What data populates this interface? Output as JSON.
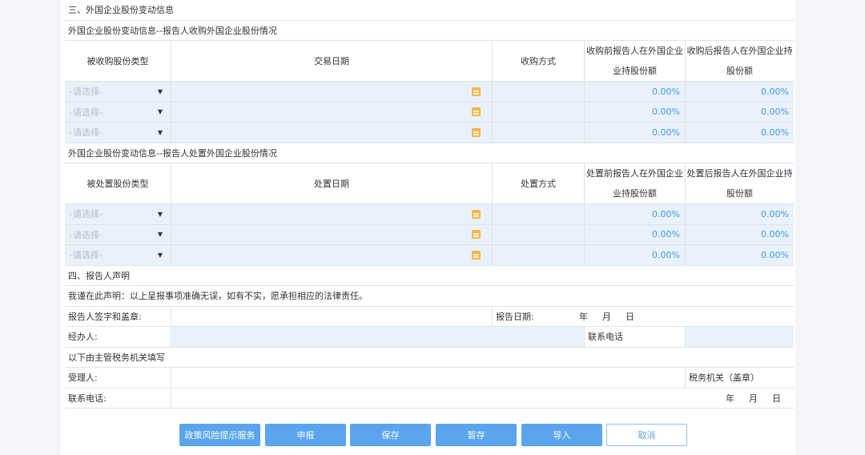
{
  "section3_title": "三、外国企业股份变动信息",
  "acquire": {
    "title": "外国企业股份变动信息--报告人收购外国企业股份情况",
    "headers": [
      "被收购股份类型",
      "交易日期",
      "收购方式",
      "收购前报告人在外国企业业持股份额",
      "收购后报告人在外国企业持股份额"
    ],
    "rows": [
      {
        "type": "-请选择-",
        "pct_before": "0.00%",
        "pct_after": "0.00%"
      },
      {
        "type": "-请选择-",
        "pct_before": "0.00%",
        "pct_after": "0.00%"
      },
      {
        "type": "-请选择-",
        "pct_before": "0.00%",
        "pct_after": "0.00%"
      }
    ]
  },
  "dispose": {
    "title": "外国企业股份变动信息--报告人处置外国企业股份情况",
    "headers": [
      "被处置股份类型",
      "处置日期",
      "处置方式",
      "处置前报告人在外国企业业持股份额",
      "处置后报告人在外国企业持股份额"
    ],
    "rows": [
      {
        "type": "-请选择-",
        "pct_before": "0.00%",
        "pct_after": "0.00%"
      },
      {
        "type": "-请选择-",
        "pct_before": "0.00%",
        "pct_after": "0.00%"
      },
      {
        "type": "-请选择-",
        "pct_before": "0.00%",
        "pct_after": "0.00%"
      }
    ]
  },
  "section4_title": "四、报告人声明",
  "declaration": "我谨在此声明：以上呈报事项准确无误，如有不实，愿承担相应的法律责任。",
  "signature_label": "报告人签字和盖章:",
  "report_date_label": "报告日期:",
  "date_parts": [
    "年",
    "月",
    "日"
  ],
  "handler_label": "经办人:",
  "contact_phone_label": "联系电话",
  "tax_fill_title": "以下由主管税务机关填写",
  "receiver_label": "受理人:",
  "tax_office_label": "税务机关（盖章）",
  "phone_label": "联系电话:",
  "buttons": {
    "policy": "政策风险提示服务",
    "submit": "申报",
    "save": "保存",
    "draft": "暂存",
    "import": "导入",
    "cancel": "取消"
  },
  "colors": {
    "primary": "#5aa5ee",
    "percent": "#3d9be9",
    "input_bg": "#e9f1fb",
    "calendar": "#f5b54a"
  }
}
